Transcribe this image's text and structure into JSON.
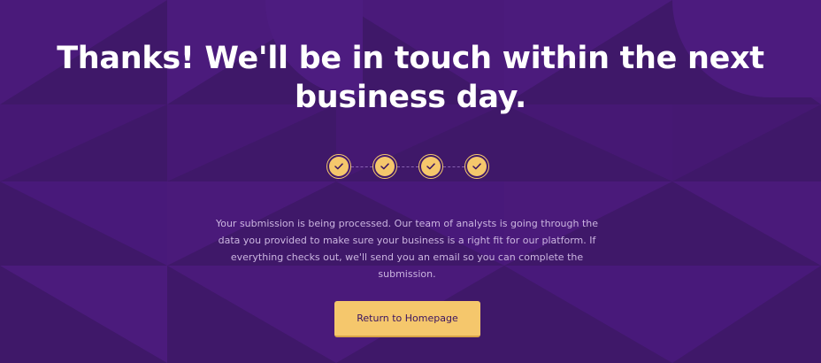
{
  "page": {
    "headline": "Thanks! We'll be in touch within the next business day.",
    "message": "Your submission is being processed. Our team of analysts is going through the data you provided to make sure your business is a right fit for our platform. If everything checks out, we'll send you an email so you can complete the submission.",
    "cta_label": "Return to Homepage"
  },
  "steps": [
    {
      "status": "complete",
      "icon": "check-icon"
    },
    {
      "status": "complete",
      "icon": "check-icon"
    },
    {
      "status": "complete",
      "icon": "check-icon"
    },
    {
      "status": "complete",
      "icon": "check-icon"
    }
  ],
  "colors": {
    "background": "#3f1869",
    "pattern_light": "#4a1a7a",
    "accent": "#f5c76c",
    "heading": "#ffffff",
    "body_text": "#cbb5e0",
    "button_text": "#3a1460"
  }
}
